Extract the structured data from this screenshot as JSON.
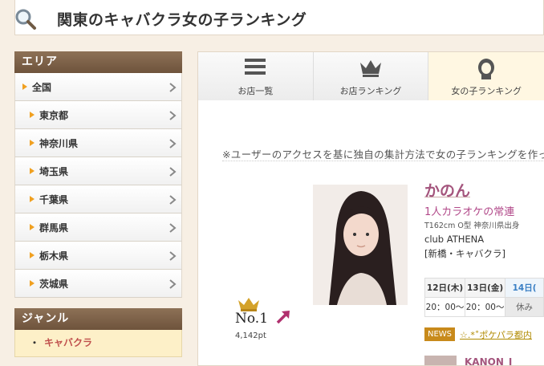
{
  "header": {
    "title": "関東のキャバクラ女の子ランキング",
    "icon": "search-icon"
  },
  "sidebar": {
    "area_heading": "エリア",
    "items": [
      {
        "label": "全国"
      },
      {
        "label": "東京都"
      },
      {
        "label": "神奈川県"
      },
      {
        "label": "埼玉県"
      },
      {
        "label": "千葉県"
      },
      {
        "label": "群馬県"
      },
      {
        "label": "栃木県"
      },
      {
        "label": "茨城県"
      }
    ],
    "genre_heading": "ジャンル",
    "genre_item": "キャバクラ",
    "genre_bullet": "・"
  },
  "tabs": [
    {
      "label": "お店一覧",
      "icon": "menu-icon"
    },
    {
      "label": "お店ランキング",
      "icon": "crown-icon"
    },
    {
      "label": "女の子ランキング",
      "icon": "girl-icon",
      "active": true
    }
  ],
  "notice": "※ユーザーのアクセスを基に独自の集計方法で女の子ランキングを作って",
  "rank": {
    "number": "No.1",
    "points": "4,142pt"
  },
  "cast": {
    "name": "かのん",
    "catchphrase": "1人カラオケの常連",
    "profile": "T162cm O型  神奈川県出身",
    "shop": "club ATHENA",
    "area": "[新橋・キャバクラ]"
  },
  "schedule": {
    "days": [
      "12日(木)",
      "13日(金)",
      "14日("
    ],
    "times": [
      "20：00～",
      "20：00～",
      "休み"
    ]
  },
  "news": {
    "badge": "NEWS",
    "text": "☆.*˚ポケパラ都内"
  },
  "blog": {
    "title": "KANON_I"
  },
  "colors": {
    "accent": "#a4557d",
    "sidebar_head": "#7b5f46",
    "highlight": "#f0a020"
  }
}
